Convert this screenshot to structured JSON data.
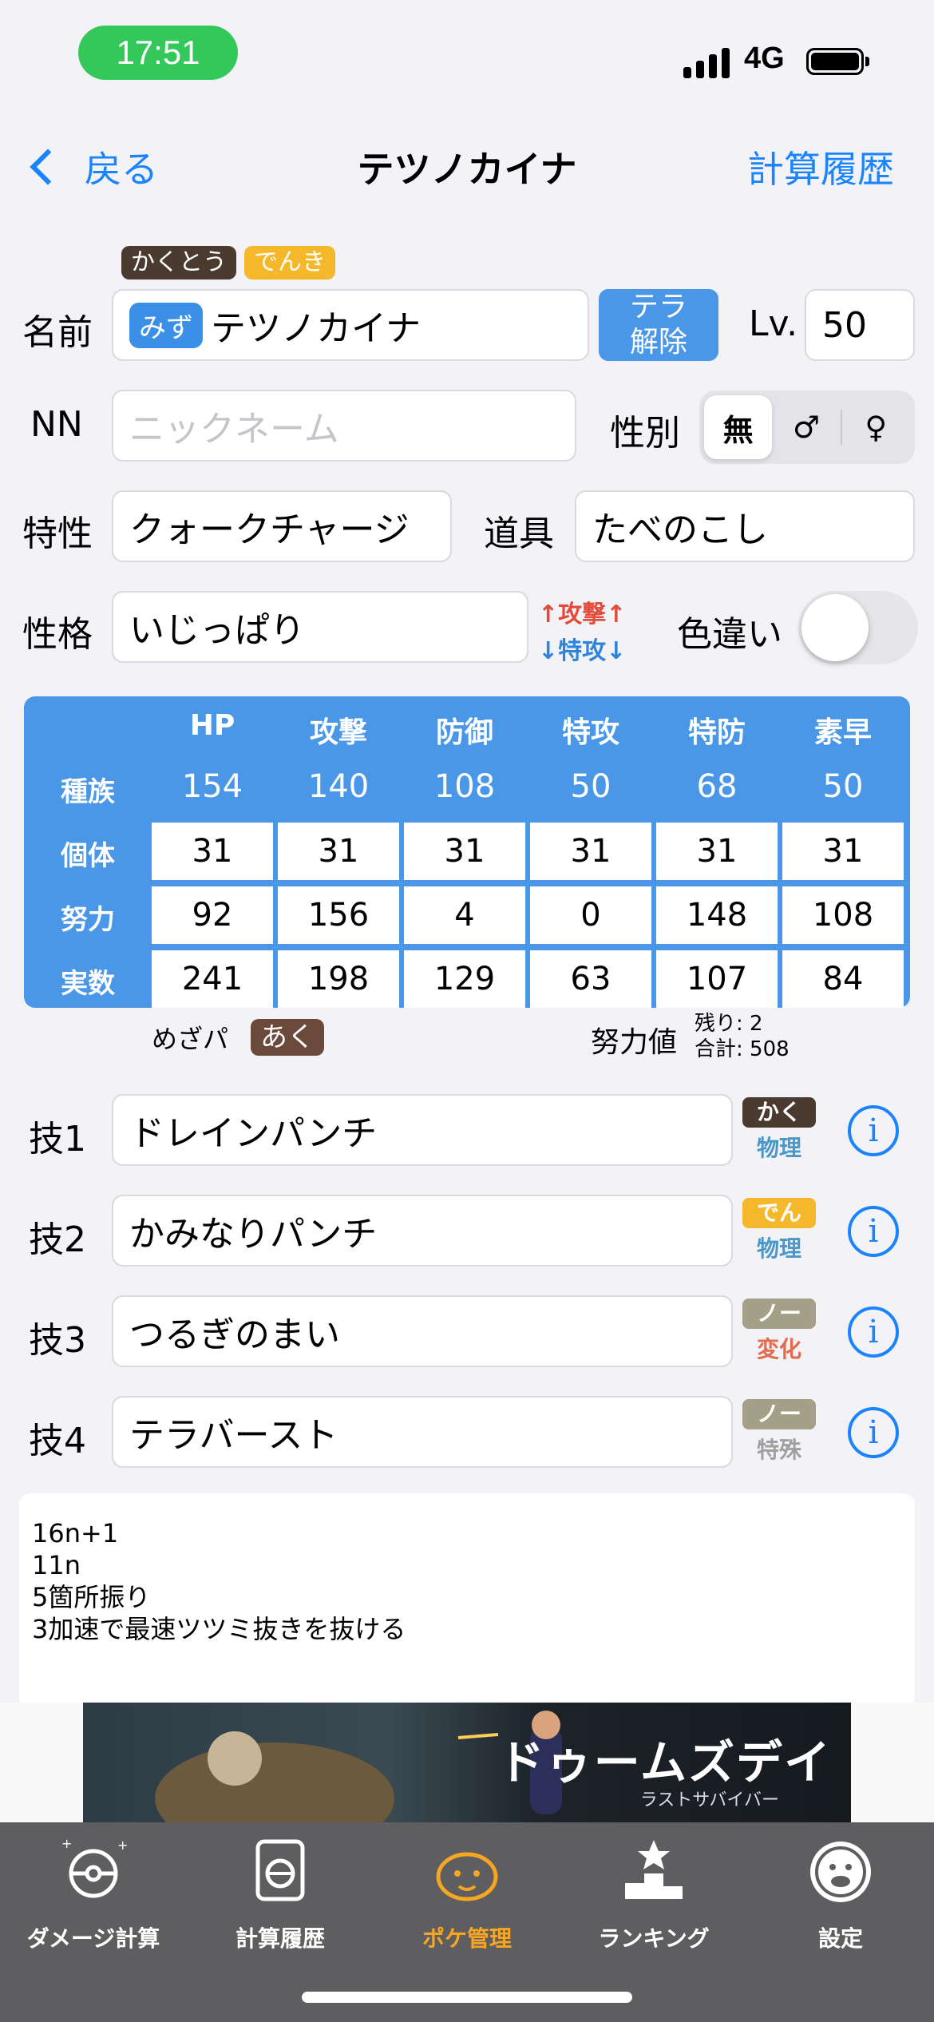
{
  "status": {
    "time": "17:51",
    "network": "4G"
  },
  "nav": {
    "back": "戻る",
    "title": "テツノカイナ",
    "history": "計算履歴"
  },
  "types": [
    "かくとう",
    "でんき"
  ],
  "form": {
    "name_label": "名前",
    "tera_type": "みず",
    "name_value": "テツノカイナ",
    "tera_button_1": "テラ",
    "tera_button_2": "解除",
    "lv_label": "Lv.",
    "lv_value": "50",
    "nn_label": "NN",
    "nn_placeholder": "ニックネーム",
    "gender_label": "性別",
    "gender_options": [
      "無",
      "♂",
      "♀"
    ],
    "ability_label": "特性",
    "ability_value": "クォークチャージ",
    "item_label": "道具",
    "item_value": "たべのこし",
    "nature_label": "性格",
    "nature_value": "いじっぱり",
    "nature_up": "↑攻撃↑",
    "nature_down": "↓特攻↓",
    "shiny_label": "色違い"
  },
  "stats": {
    "headers": [
      "HP",
      "攻撃",
      "防御",
      "特攻",
      "特防",
      "素早"
    ],
    "rows": [
      {
        "label": "種族",
        "values": [
          "154",
          "140",
          "108",
          "50",
          "68",
          "50"
        ]
      },
      {
        "label": "個体",
        "values": [
          "31",
          "31",
          "31",
          "31",
          "31",
          "31"
        ]
      },
      {
        "label": "努力",
        "values": [
          "92",
          "156",
          "4",
          "0",
          "148",
          "108"
        ]
      },
      {
        "label": "実数",
        "values": [
          "241",
          "198",
          "129",
          "63",
          "107",
          "84"
        ]
      }
    ]
  },
  "mezapa": {
    "label": "めざパ",
    "type": "あく"
  },
  "ev": {
    "label": "努力値",
    "remaining": "残り: 2",
    "total": "合計: 508"
  },
  "moves": [
    {
      "label": "技1",
      "name": "ドレインパンチ",
      "type": "かく",
      "category": "物理"
    },
    {
      "label": "技2",
      "name": "かみなりパンチ",
      "type": "でん",
      "category": "物理"
    },
    {
      "label": "技3",
      "name": "つるぎのまい",
      "type": "ノー",
      "category": "変化"
    },
    {
      "label": "技4",
      "name": "テラバースト",
      "type": "ノー",
      "category": "特殊"
    }
  ],
  "memo": [
    "16n+1",
    "11n",
    "5箇所振り",
    "3加速で最速ツツミ抜きを抜ける"
  ],
  "ad": {
    "title": "ドゥームズデイ",
    "subtitle": "ラストサバイバー"
  },
  "tabs": [
    {
      "label": "ダメージ計算",
      "icon": "pokeball-sparkle-icon",
      "active": false
    },
    {
      "label": "計算履歴",
      "icon": "history-device-icon",
      "active": false
    },
    {
      "label": "ポケ管理",
      "icon": "pokemon-face-icon",
      "active": true
    },
    {
      "label": "ランキング",
      "icon": "podium-icon",
      "active": false
    },
    {
      "label": "設定",
      "icon": "settings-face-icon",
      "active": false
    }
  ]
}
